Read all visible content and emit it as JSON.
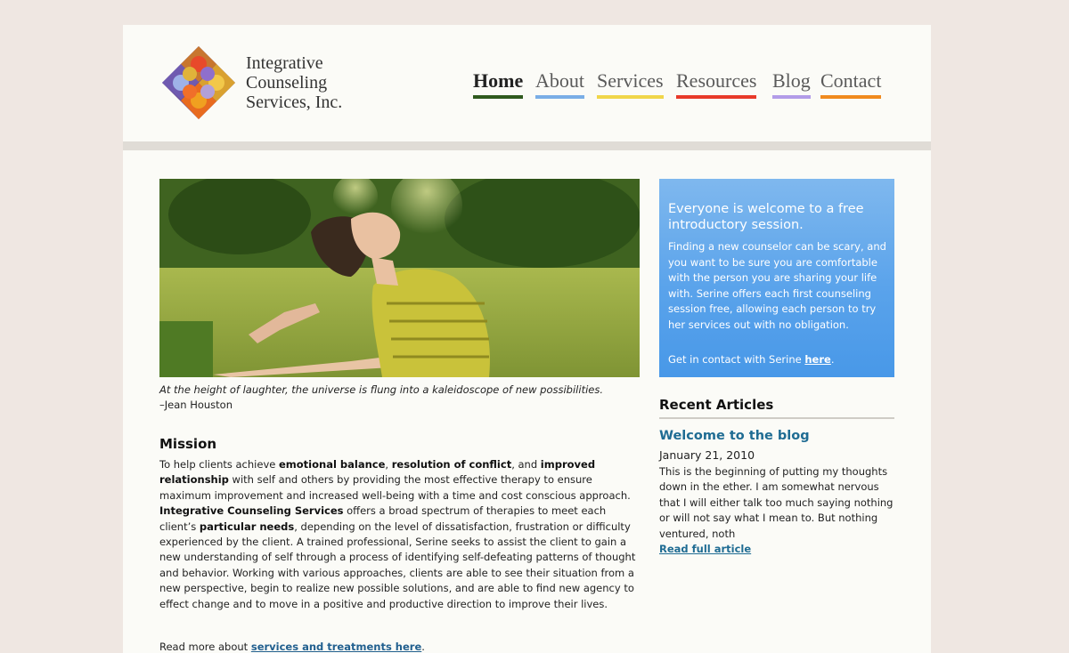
{
  "logo": {
    "line1": "Integrative",
    "line2": "Counseling",
    "line3": "Services, Inc."
  },
  "nav": [
    {
      "label": "Home",
      "color": "#2f5a1e",
      "active": true
    },
    {
      "label": "About",
      "color": "#7aaee6",
      "active": false
    },
    {
      "label": "Services",
      "color": "#f0d64a",
      "active": false
    },
    {
      "label": "Resources",
      "color": "#e83a2a",
      "active": false
    },
    {
      "label": "Blog",
      "color": "#b29ce8",
      "active": false
    },
    {
      "label": "Contact",
      "color": "#f08a1e",
      "active": false
    }
  ],
  "hero": {
    "quote": "At the height of laughter, the universe is flung into a kaleidoscope of new possibilities.",
    "author": "–Jean Houston"
  },
  "mission": {
    "title": "Mission",
    "p1": "To help clients achieve ",
    "b1": "emotional balance",
    "p2": ", ",
    "b2": "resolution of conflict",
    "p3": ", and ",
    "b3": "improved relationship",
    "p4": " with self and others by providing the most effective therapy to ensure maximum improvement and increased well-being with a time and cost conscious approach. ",
    "b4": "Integrative Counseling Services",
    "p5": " offers a broad spectrum of therapies to meet each client’s ",
    "b5": "particular needs",
    "p6": ", depending on the level of dissatisfaction, frustration or difficulty experienced by the client.  A trained professional, Serine seeks to assist the client to gain a new understanding of self through a process of identifying self-defeating patterns of thought and behavior.  Working with various approaches, clients are able to see their situation from a new perspective, begin to realize new possible solutions,  and are able to find new agency to effect change and to move in a positive and productive direction to improve their lives.",
    "readmore_prefix": "Read more about ",
    "readmore_link": "services and treatments here",
    "readmore_suffix": "."
  },
  "callout": {
    "title": "Everyone is welcome to a free introductory session.",
    "body": "Finding a new counselor can be scary, and you want to be sure you are comfortable with the person you are sharing your life with. Serine offers each first counseling session free, allowing each person to try her services out with no obligation.",
    "contact_prefix": "Get in contact with Serine ",
    "contact_link": "here",
    "contact_suffix": "."
  },
  "recent": {
    "title": "Recent Articles",
    "article_title": "Welcome to the blog",
    "article_date": "January 21, 2010",
    "article_excerpt": "This is the beginning of putting my thoughts down in the ether.  I am somewhat nervous that I will either talk too much saying nothing or will not say what I mean to.  But nothing ventured, noth",
    "article_link": "Read full article"
  }
}
